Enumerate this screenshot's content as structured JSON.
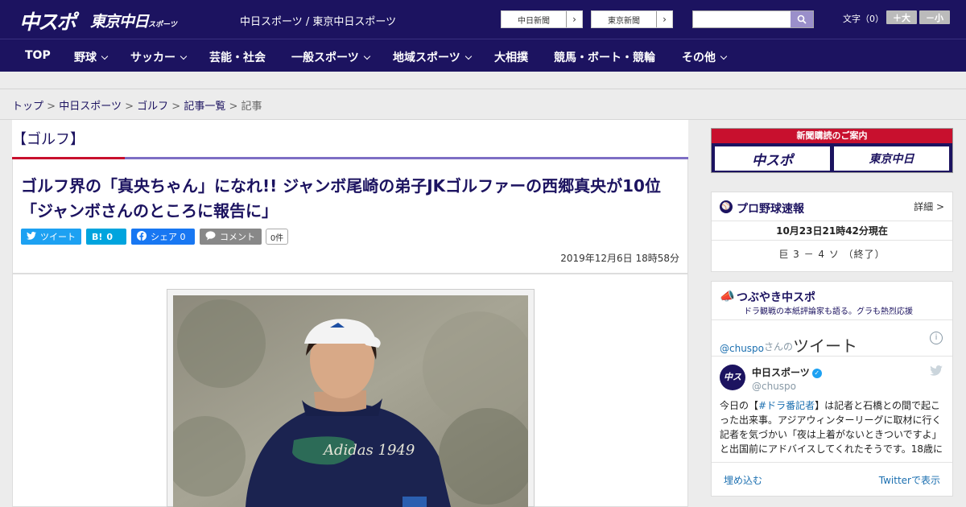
{
  "header": {
    "logo_chuspo": "中スポ",
    "logo_tokyo": "東京中日",
    "logo_tokyo_small": "スポーツ",
    "site_name": "中日スポーツ / 東京中日スポーツ",
    "link_chunichi": "中日新聞",
    "link_tokyo": "東京新聞",
    "search_placeholder": "",
    "font_size_label": "文字（0）",
    "font_larger": "＋大",
    "font_smaller": "－小"
  },
  "nav": {
    "items": [
      "TOP",
      "野球",
      "サッカー",
      "芸能・社会",
      "一般スポーツ",
      "地域スポーツ",
      "大相撲",
      "競馬・ボート・競輪",
      "その他"
    ]
  },
  "breadcrumb": {
    "items": [
      "トップ",
      "中日スポーツ",
      "ゴルフ",
      "記事一覧"
    ],
    "current": "記事",
    "sep": ">"
  },
  "article": {
    "category": "【ゴルフ】",
    "title": "ゴルフ界の「真央ちゃん」になれ!! ジャンボ尾崎の弟子JKゴルファーの西郷真央が10位「ジャンボさんのところに報告に」",
    "share": {
      "tweet": "ツイート",
      "hatena_label": "B!",
      "hatena_count": "0",
      "facebook": "シェア 0",
      "comment": "コメント",
      "comment_count": "0件"
    },
    "date": "2019年12月6日 18時58分",
    "photo_text": "Adidas 1949"
  },
  "sidebar": {
    "banner_title": "新聞購読のご案内",
    "banner_left": "中スポ",
    "banner_right": "東京中日",
    "pro_title": "プロ野球速報",
    "pro_detail": "詳細 >",
    "pro_asof": "10月23日21時42分現在",
    "pro_score": "巨 3 － 4 ソ （終了）",
    "tweet_title": "つぶやき中スポ",
    "tweet_sub": "ドラ観戦の本紙評論家も語る。グラも熱烈応援",
    "tweet_handle_link": "@chuspo",
    "tweet_san": "さんの",
    "tweet_word": "ツイート",
    "tweet_name": "中日スポーツ",
    "tweet_at": "@chuspo",
    "tweet_body_prefix": "今日の【",
    "tweet_tag": "#ドラ番記者",
    "tweet_body_rest": "】は記者と石橋との間で起こった出来事。アジアウィンターリーグに取材に行く記者を気づかい「夜は上着がないときついですよ」と出国前にアドバイスしてくれたそうです。18歳に",
    "tweet_embed": "埋め込む",
    "tweet_view": "Twitterで表示",
    "avatar_text": "中スポ"
  },
  "colors": {
    "navy": "#1c1360",
    "red": "#c8102e",
    "twitter": "#1da1f2",
    "hatena": "#00a4de",
    "facebook": "#1877f2",
    "comment": "#888888"
  }
}
